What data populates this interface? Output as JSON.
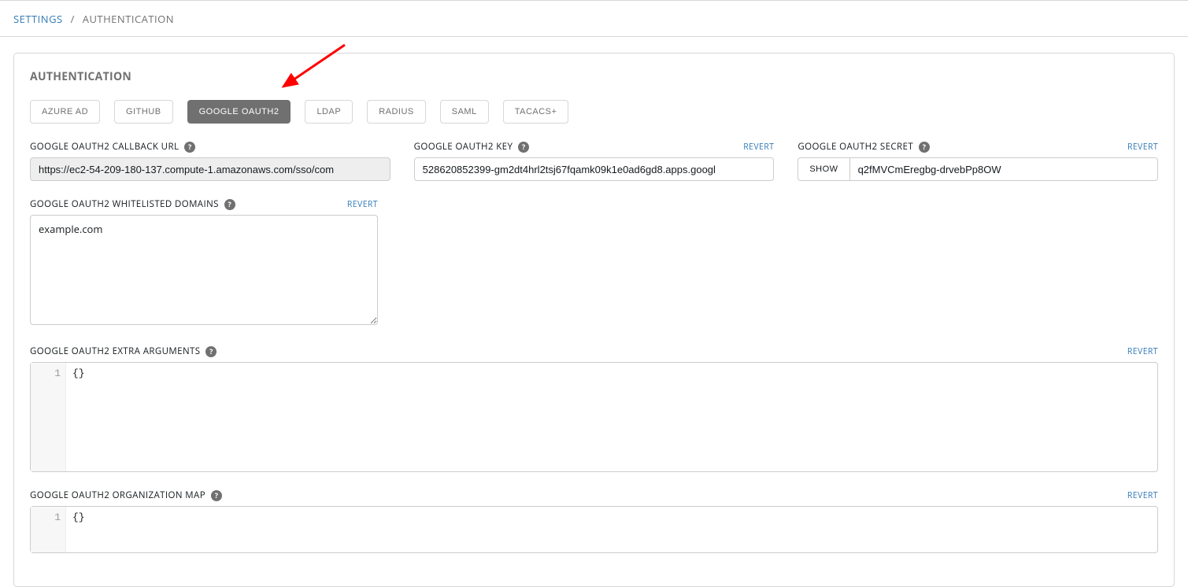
{
  "breadcrumb": {
    "root": "SETTINGS",
    "sep": "/",
    "current": "AUTHENTICATION"
  },
  "panel": {
    "title": "AUTHENTICATION"
  },
  "tabs": [
    {
      "label": "AZURE AD",
      "active": false
    },
    {
      "label": "GITHUB",
      "active": false
    },
    {
      "label": "GOOGLE OAUTH2",
      "active": true
    },
    {
      "label": "LDAP",
      "active": false
    },
    {
      "label": "RADIUS",
      "active": false
    },
    {
      "label": "SAML",
      "active": false
    },
    {
      "label": "TACACS+",
      "active": false
    }
  ],
  "fields": {
    "callback_url": {
      "label": "GOOGLE OAUTH2 CALLBACK URL",
      "value": "https://ec2-54-209-180-137.compute-1.amazonaws.com/sso/com"
    },
    "key": {
      "label": "GOOGLE OAUTH2 KEY",
      "revert": "REVERT",
      "value": "528620852399-gm2dt4hrl2tsj67fqamk09k1e0ad6gd8.apps.googl"
    },
    "secret": {
      "label": "GOOGLE OAUTH2 SECRET",
      "revert": "REVERT",
      "show": "SHOW",
      "value": "q2fMVCmEregbg-drvebPp8OW"
    },
    "whitelisted": {
      "label": "GOOGLE OAUTH2 WHITELISTED DOMAINS",
      "revert": "REVERT",
      "value": "example.com"
    },
    "extra_args": {
      "label": "GOOGLE OAUTH2 EXTRA ARGUMENTS",
      "revert": "REVERT",
      "line_no": "1",
      "value": "{}"
    },
    "org_map": {
      "label": "GOOGLE OAUTH2 ORGANIZATION MAP",
      "revert": "REVERT",
      "line_no": "1",
      "value": "{}"
    }
  },
  "help_tooltip": "?"
}
